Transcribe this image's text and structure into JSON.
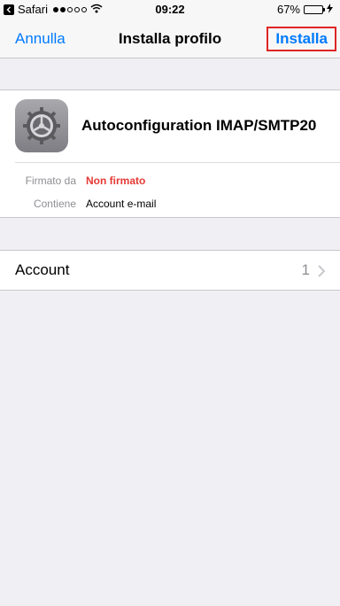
{
  "status": {
    "carrier": "Safari",
    "time": "09:22",
    "battery_pct": "67%",
    "battery_level": 0.67
  },
  "nav": {
    "left": "Annulla",
    "title": "Installa profilo",
    "right": "Installa"
  },
  "profile": {
    "name": "Autoconfiguration IMAP/SMTP20",
    "details": [
      {
        "label": "Firmato da",
        "value": "Non firmato"
      },
      {
        "label": "Contiene",
        "value": "Account e-mail"
      }
    ]
  },
  "account": {
    "label": "Account",
    "count": "1"
  },
  "colors": {
    "accent": "#007aff",
    "warning": "#e53935",
    "highlight_border": "#e02424",
    "battery_fill": "#4cd964"
  },
  "icons": [
    "back-icon",
    "signal-icon",
    "wifi-icon",
    "battery-icon",
    "charging-icon",
    "settings-gear-icon",
    "chevron-right-icon"
  ]
}
